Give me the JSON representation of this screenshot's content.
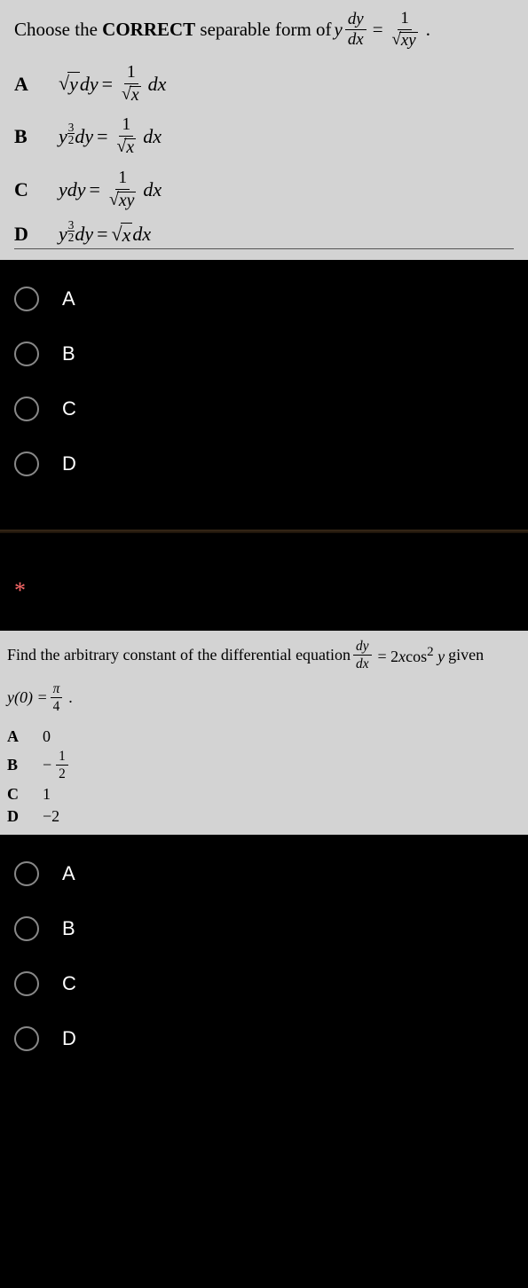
{
  "q1": {
    "prompt_prefix": "Choose the ",
    "prompt_bold": "CORRECT",
    "prompt_suffix": " separable form of ",
    "options": {
      "a_label": "A",
      "b_label": "B",
      "c_label": "C",
      "d_label": "D"
    }
  },
  "radios": {
    "a": "A",
    "b": "B",
    "c": "C",
    "d": "D"
  },
  "star": "*",
  "q2": {
    "prompt": "Find the arbitrary constant of the differential equation ",
    "given": " given",
    "condition_label": "y(0) = ",
    "options": {
      "a_label": "A",
      "a_value": "0",
      "b_label": "B",
      "c_label": "C",
      "c_value": "1",
      "d_label": "D",
      "d_value": "−2"
    }
  },
  "radios2": {
    "a": "A",
    "b": "B",
    "c": "C",
    "d": "D"
  }
}
